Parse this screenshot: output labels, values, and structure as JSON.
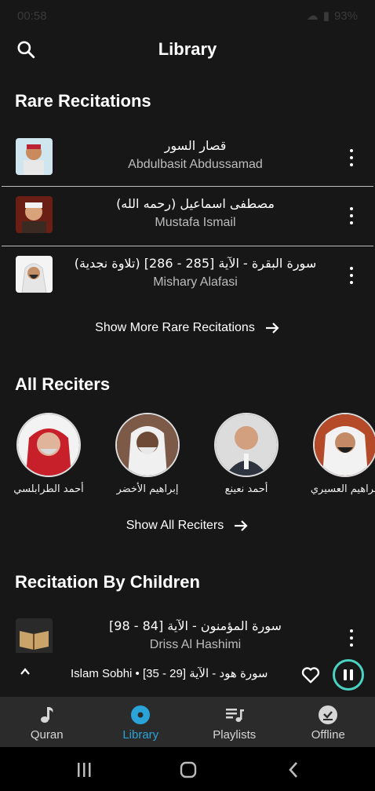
{
  "status_bar": {
    "time": "00:58",
    "battery": "93%"
  },
  "header": {
    "title": "Library"
  },
  "rare": {
    "title": "Rare Recitations",
    "items": [
      {
        "arabic": "قصار السور",
        "reciter": "Abdulbasit Abdussamad"
      },
      {
        "arabic": "مصطفى اسماعيل (رحمه الله)",
        "reciter": "Mustafa Ismail"
      },
      {
        "arabic": "سورة  البقرة - الآية [285 - 286] (تلاوة نجدية)",
        "reciter": "Mishary Alafasi"
      }
    ],
    "show_more_label": "Show More Rare Recitations"
  },
  "all_reciters": {
    "title": "All Reciters",
    "items": [
      {
        "name": "أحمد الطرابلسي"
      },
      {
        "name": "إبراهيم الأخضر"
      },
      {
        "name": "أحمد نعينع"
      },
      {
        "name": "إبراهيم العسيري"
      }
    ],
    "show_all_label": "Show All Reciters"
  },
  "children": {
    "title": "Recitation By Children",
    "items": [
      {
        "arabic": "سورة المؤمنون - الآية [84 - 98]",
        "reciter": "Driss Al Hashimi"
      }
    ]
  },
  "player": {
    "now_playing": "Islam Sobhi • سورة هود - الآية [29 - 35]",
    "accent_color": "#4ad3c3"
  },
  "bottom_nav": {
    "items": [
      {
        "label": "Quran",
        "icon": "music-note-icon"
      },
      {
        "label": "Library",
        "icon": "disc-icon"
      },
      {
        "label": "Playlists",
        "icon": "playlist-icon"
      },
      {
        "label": "Offline",
        "icon": "offline-download-icon"
      }
    ],
    "active_color": "#2aa3d8"
  }
}
